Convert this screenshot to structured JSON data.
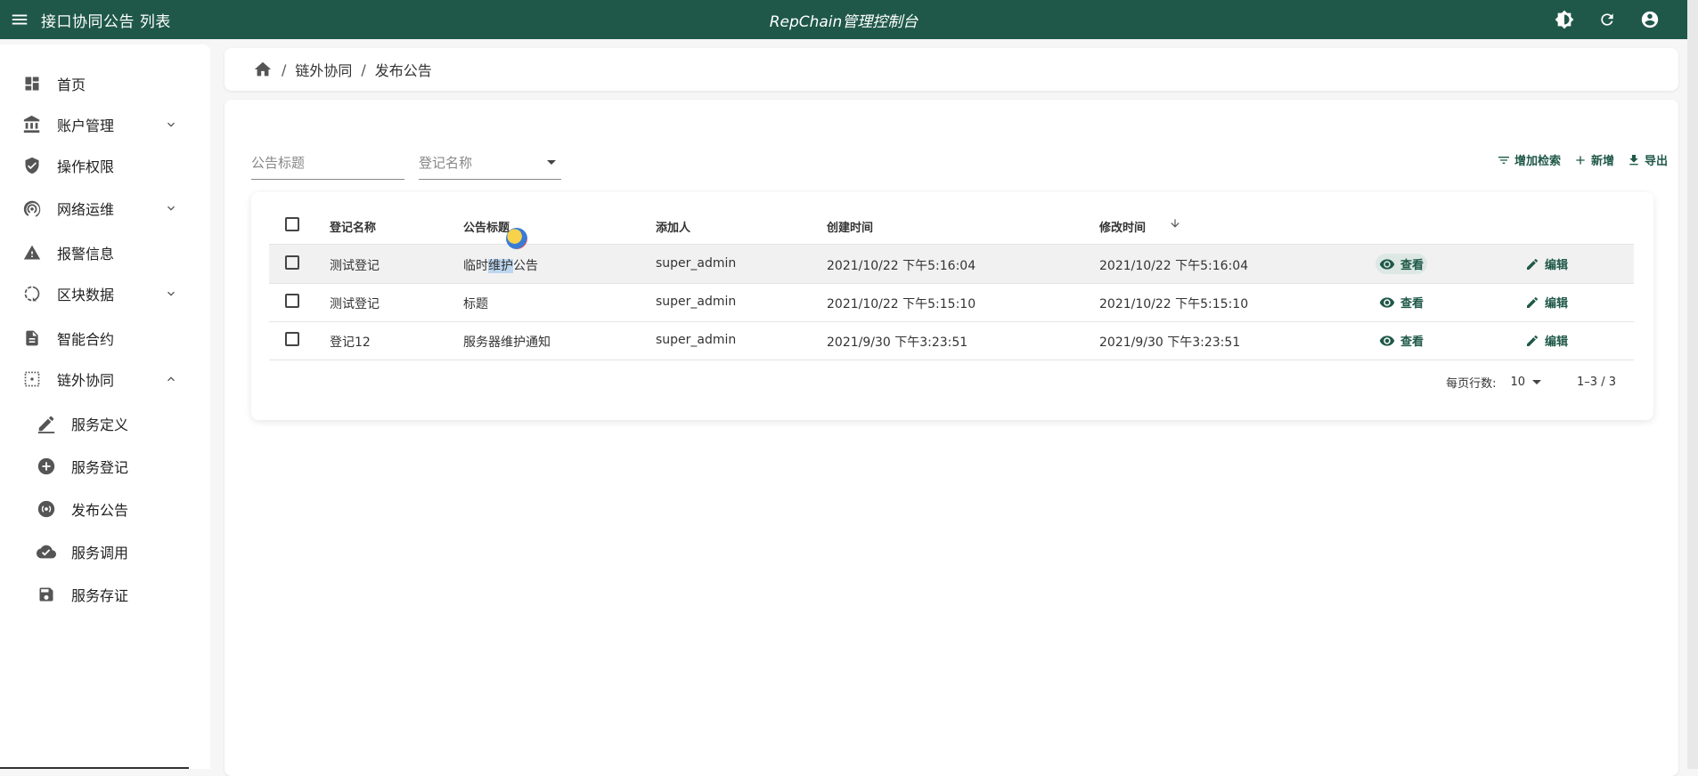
{
  "appbar": {
    "page_title": "接口协同公告 列表",
    "app_title": "RepChain管理控制台"
  },
  "sidebar": {
    "items": [
      {
        "label": "首页"
      },
      {
        "label": "账户管理"
      },
      {
        "label": "操作权限"
      },
      {
        "label": "网络运维"
      },
      {
        "label": "报警信息"
      },
      {
        "label": "区块数据"
      },
      {
        "label": "智能合约"
      },
      {
        "label": "链外协同"
      }
    ],
    "sub_items": [
      {
        "label": "服务定义"
      },
      {
        "label": "服务登记"
      },
      {
        "label": "发布公告"
      },
      {
        "label": "服务调用"
      },
      {
        "label": "服务存证"
      }
    ]
  },
  "breadcrumb": {
    "items": [
      "链外协同",
      "发布公告"
    ],
    "separator": "/"
  },
  "filters": {
    "title_placeholder": "公告标题",
    "registration_placeholder": "登记名称"
  },
  "toolbar": {
    "add_search_label": "增加检索",
    "new_label": "新增",
    "export_label": "导出"
  },
  "table": {
    "headers": {
      "registration": "登记名称",
      "title": "公告标题",
      "creator": "添加人",
      "created": "创建时间",
      "modified": "修改时间"
    },
    "rows": [
      {
        "registration": "测试登记",
        "title_a": "临时",
        "title_b": "维护",
        "title_c": "公告",
        "creator": "super_admin",
        "created": "2021/10/22 下午5:16:04",
        "modified": "2021/10/22 下午5:16:04"
      },
      {
        "registration": "测试登记",
        "title": "标题",
        "creator": "super_admin",
        "created": "2021/10/22 下午5:15:10",
        "modified": "2021/10/22 下午5:15:10"
      },
      {
        "registration": "登记12",
        "title": "服务器维护通知",
        "creator": "super_admin",
        "created": "2021/9/30 下午3:23:51",
        "modified": "2021/9/30 下午3:23:51"
      }
    ],
    "view_label": "查看",
    "edit_label": "编辑"
  },
  "pagination": {
    "rows_per_page_label": "每页行数:",
    "rows_per_page": "10",
    "range": "1–3 / 3"
  }
}
